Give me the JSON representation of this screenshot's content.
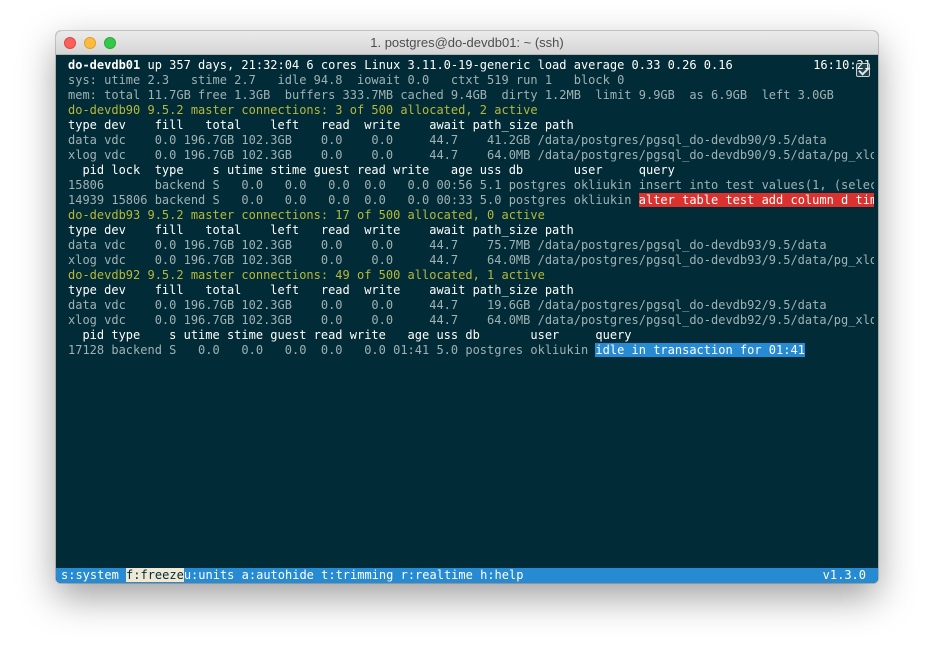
{
  "window": {
    "title": "1. postgres@do-devdb01: ~ (ssh)"
  },
  "terminal": {
    "host": "do-devdb01",
    "uptime_line": " up 357 days, 21:32:04 6 cores Linux 3.11.0-19-generic load average 0.33 0.26 0.16",
    "clock": "16:10:21",
    "sys_line": "sys: utime 2.3   stime 2.7   idle 94.8  iowait 0.0   ctxt 519 run 1   block 0",
    "mem_line": "mem: total 11.7GB free 1.3GB  buffers 333.7MB cached 9.4GB  dirty 1.2MB  limit 9.9GB  as 6.9GB  left 3.0GB",
    "instances": [
      {
        "title": "do-devdb90 9.5.2 master connections: 3 of 500 allocated, 2 active",
        "disk_header": "type dev    fill   total    left   read  write    await path_size path",
        "disk_rows": [
          "data vdc    0.0 196.7GB 102.3GB    0.0    0.0     44.7    41.2GB /data/postgres/pgsql_do-devdb90/9.5/data",
          "xlog vdc    0.0 196.7GB 102.3GB    0.0    0.0     44.7    64.0MB /data/postgres/pgsql_do-devdb90/9.5/data/pg_xlog"
        ],
        "proc_header": "  pid lock  type    s utime stime guest read write   age uss db       user     query",
        "proc_rows": [
          {
            "text": "15806       backend S   0.0   0.0   0.0  0.0   0.0 00:56 5.1 postgres okliukin ",
            "query": "insert into test values(1, (selec...",
            "style": "normal"
          },
          {
            "text": "14939 15806 backend S   0.0   0.0   0.0  0.0   0.0 00:33 5.0 postgres okliukin ",
            "query": "alter table test add column d tim...",
            "style": "red"
          }
        ]
      },
      {
        "title": "do-devdb93 9.5.2 master connections: 17 of 500 allocated, 0 active",
        "disk_header": "type dev    fill   total    left   read  write    await path_size path",
        "disk_rows": [
          "data vdc    0.0 196.7GB 102.3GB    0.0    0.0     44.7    75.7MB /data/postgres/pgsql_do-devdb93/9.5/data",
          "xlog vdc    0.0 196.7GB 102.3GB    0.0    0.0     44.7    64.0MB /data/postgres/pgsql_do-devdb93/9.5/data/pg_xlog"
        ]
      },
      {
        "title": "do-devdb92 9.5.2 master connections: 49 of 500 allocated, 1 active",
        "disk_header": "type dev    fill   total    left   read  write    await path_size path",
        "disk_rows": [
          "data vdc    0.0 196.7GB 102.3GB    0.0    0.0     44.7    19.6GB /data/postgres/pgsql_do-devdb92/9.5/data",
          "xlog vdc    0.0 196.7GB 102.3GB    0.0    0.0     44.7    64.0MB /data/postgres/pgsql_do-devdb92/9.5/data/pg_xlog"
        ],
        "proc_header": "  pid type    s utime stime guest read write   age uss db       user     query",
        "proc_rows": [
          {
            "text": "17128 backend S   0.0   0.0   0.0  0.0   0.0 01:41 5.0 postgres okliukin ",
            "query": "idle in transaction for 01:41",
            "style": "blue"
          }
        ]
      }
    ]
  },
  "statusbar": {
    "items": [
      {
        "label": "s:system",
        "active": false
      },
      {
        "label": "f:freeze",
        "active": true
      },
      {
        "label": "u:units",
        "active": false
      },
      {
        "label": "a:autohide",
        "active": false
      },
      {
        "label": "t:trimming",
        "active": false
      },
      {
        "label": "r:realtime",
        "active": false
      },
      {
        "label": "h:help",
        "active": false
      }
    ],
    "version": "v1.3.0"
  },
  "colors": {
    "background": "#012b36",
    "text": "#93a1a1",
    "instance_title": "#b5b93a",
    "highlight_red": "#dc322f",
    "highlight_blue": "#268bd2",
    "statusbar": "#268bd2"
  }
}
